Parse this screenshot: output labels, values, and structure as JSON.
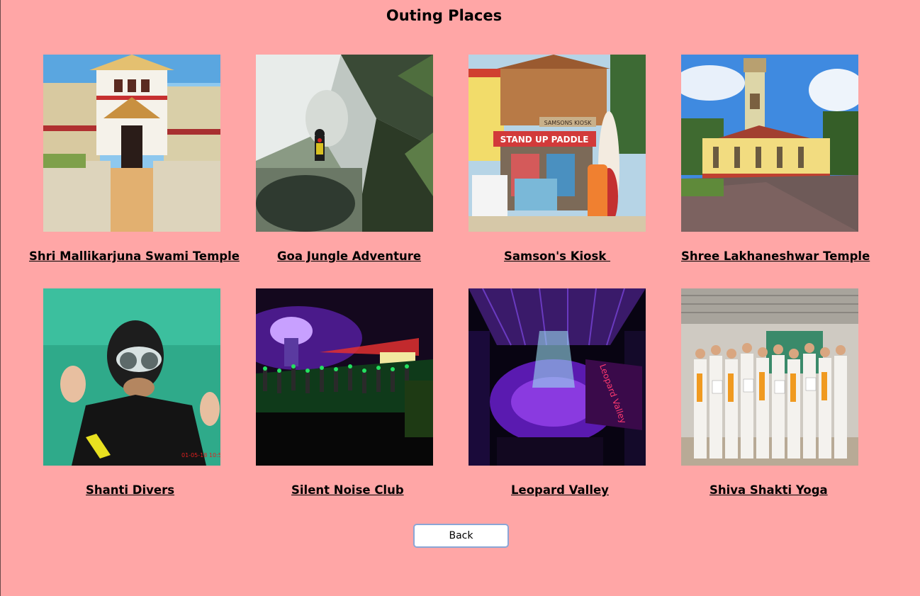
{
  "page": {
    "title": "Outing Places",
    "background": "#ffa6a6"
  },
  "places": [
    {
      "label": "Shri Mallikarjuna Swami Temple"
    },
    {
      "label": "Goa Jungle Adventure"
    },
    {
      "label": "Samson's Kiosk "
    },
    {
      "label": "Shree Lakhaneshwar Temple"
    },
    {
      "label": "Shanti Divers"
    },
    {
      "label": "Silent Noise Club"
    },
    {
      "label": "Leopard Valley"
    },
    {
      "label": "Shiva Shakti Yoga"
    }
  ],
  "photo_text": {
    "kiosk_sign": "SAMSONS KIOSK",
    "kiosk_banner": "STAND UP PADDLE",
    "leopard_sign": "Leopard Valley",
    "diver_timestamp": "01-05-18 10:52:42"
  },
  "back_button": {
    "label": "Back"
  }
}
